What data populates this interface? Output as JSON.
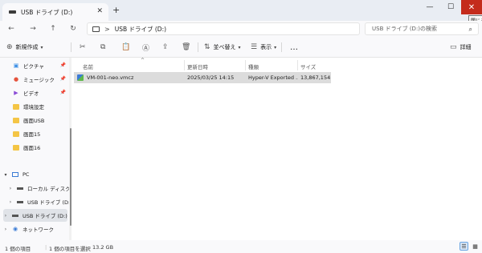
{
  "window": {
    "tab_title": "USB ドライブ (D:)",
    "tab_close": "✕",
    "new_tab": "+",
    "minimize": "—",
    "maximize": "☐",
    "close": "✕",
    "tooltip": "閉じる"
  },
  "address": {
    "separator": ">",
    "crumb": "USB ドライブ (D:)",
    "search_placeholder": "USB ドライブ (D:)の検索"
  },
  "toolbar": {
    "new_label": "新規作成",
    "sort_label": "並べ替え",
    "view_label": "表示",
    "more_label": "…",
    "details_label": "詳細"
  },
  "sidebar": {
    "items": [
      {
        "label": "ピクチャ",
        "icon": "pictures-icon"
      },
      {
        "label": "ミュージック",
        "icon": "music-icon"
      },
      {
        "label": "ビデオ",
        "icon": "videos-icon"
      },
      {
        "label": "環境設定",
        "icon": "folder-icon"
      },
      {
        "label": "画面USB",
        "icon": "folder-icon"
      },
      {
        "label": "画面15",
        "icon": "folder-icon"
      },
      {
        "label": "画面16",
        "icon": "folder-icon"
      }
    ],
    "pc_label": "PC",
    "local_disk_label": "ローカル ディスク",
    "usb_label_1": "USB ドライブ (D:",
    "usb_label_2": "USB ドライブ (D:)",
    "network_label": "ネットワーク"
  },
  "columns": {
    "name": "名前",
    "modified": "更新日時",
    "type": "種類",
    "size": "サイズ"
  },
  "files": [
    {
      "name": "VM-001-neo.vmcz",
      "modified": "2025/03/25 14:15",
      "type": "Hyper-V Exported ...",
      "size": "13,867,154 ..."
    }
  ],
  "status": {
    "count": "1 個の項目",
    "selected": "1 個の項目を選択",
    "size": "13.2 GB"
  },
  "colors": {
    "close_red": "#c42b1c",
    "folder_yellow": "#f4c545",
    "selection_gray": "#dcdcdc"
  }
}
